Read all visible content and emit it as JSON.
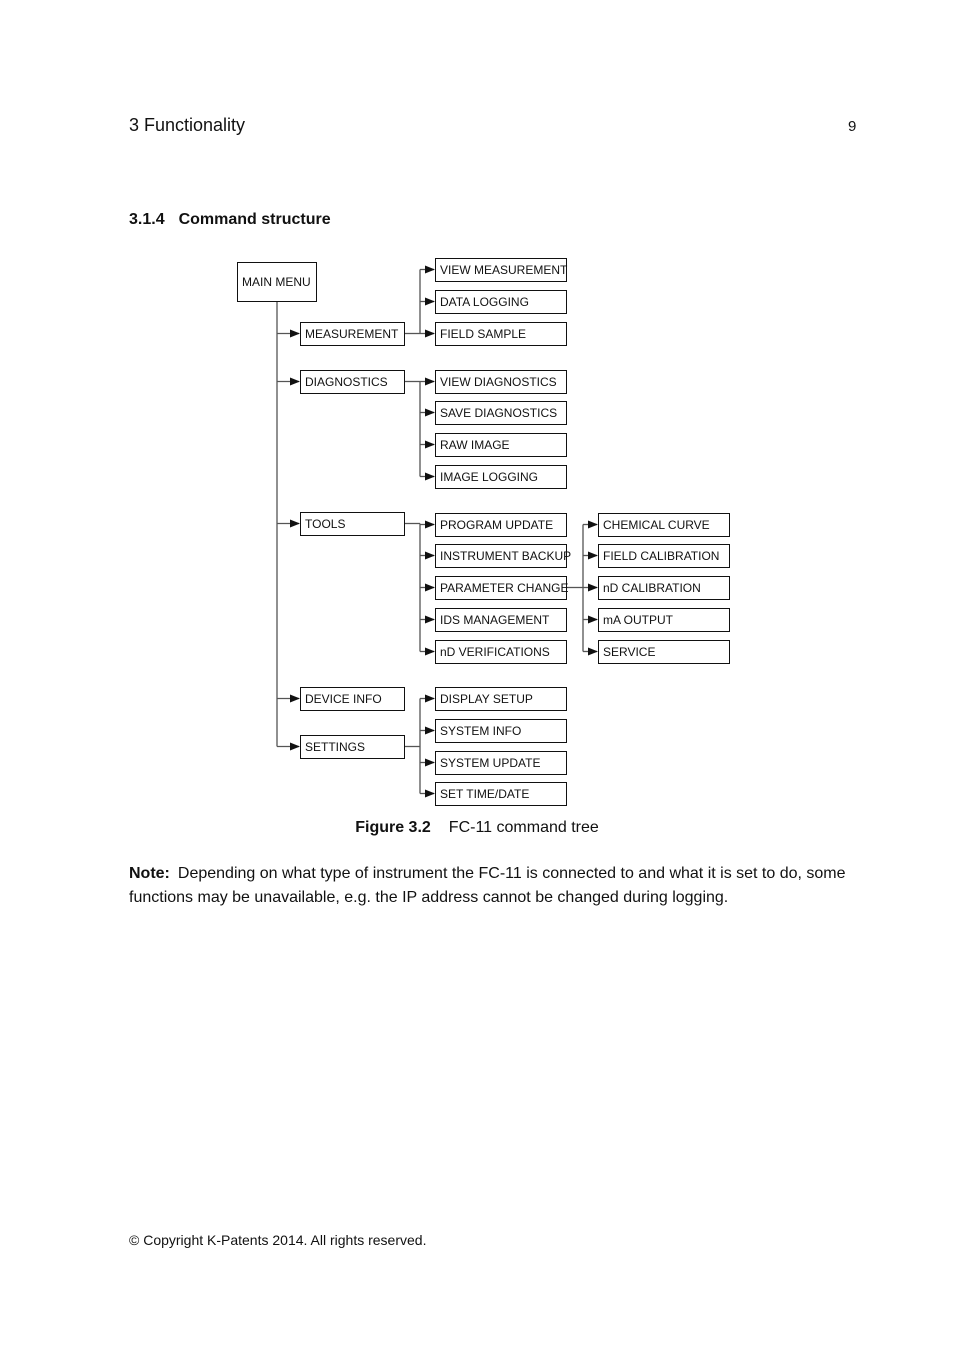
{
  "header": {
    "chapter": "3 Functionality",
    "page_number": "9"
  },
  "section": {
    "number": "3.1.4",
    "title": "Command structure"
  },
  "diagram": {
    "root": "MAIN MENU",
    "groups": [
      {
        "label": "MEASUREMENT",
        "children": [
          "VIEW MEASUREMENT",
          "DATA LOGGING",
          "FIELD SAMPLE"
        ]
      },
      {
        "label": "DIAGNOSTICS",
        "children": [
          "VIEW DIAGNOSTICS",
          "SAVE DIAGNOSTICS",
          "RAW IMAGE",
          "IMAGE LOGGING"
        ]
      },
      {
        "label": "TOOLS",
        "children": [
          "PROGRAM UPDATE",
          "INSTRUMENT BACKUP",
          "PARAMETER CHANGE",
          "IDS MANAGEMENT",
          "nD VERIFICATIONS"
        ],
        "sub": {
          "parent": "PARAMETER CHANGE",
          "children": [
            "CHEMICAL CURVE",
            "FIELD CALIBRATION",
            "nD CALIBRATION",
            "mA OUTPUT",
            "SERVICE"
          ]
        }
      },
      {
        "label": "DEVICE INFO",
        "children": []
      },
      {
        "label": "SETTINGS",
        "children": [
          "DISPLAY SETUP",
          "SYSTEM INFO",
          "SYSTEM UPDATE",
          "SET TIME/DATE"
        ]
      }
    ]
  },
  "caption": {
    "label": "Figure 3.2",
    "text": "FC-11 command tree"
  },
  "note": {
    "label": "Note:",
    "text": "Depending on what type of instrument the FC-11 is connected to and what it is set to do, some functions may be unavailable, e.g. the IP address cannot be changed during logging."
  },
  "footer": {
    "copyright": "© Copyright K-Patents 2014.  All rights reserved."
  }
}
